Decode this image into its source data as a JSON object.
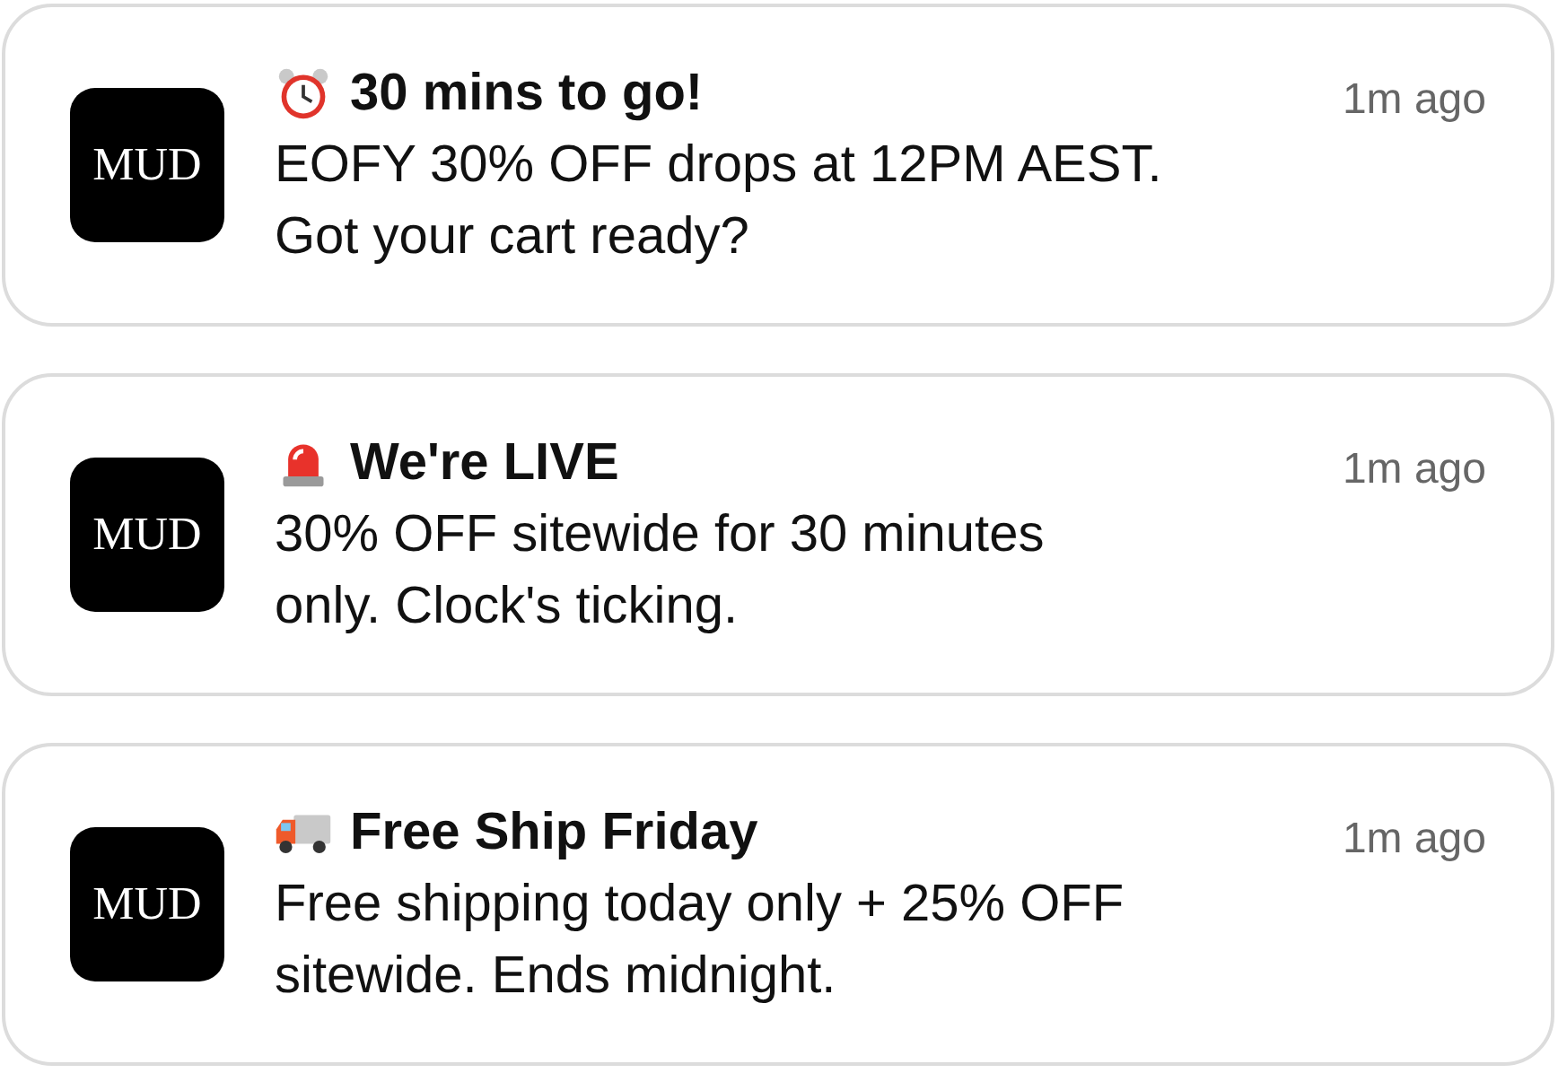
{
  "notifications": [
    {
      "kind": "alarm",
      "logo": "MUD",
      "title": "30 mins to go!",
      "time": "1m ago",
      "lines": [
        "EOFY 30% OFF drops at 12PM AEST.",
        "Got your cart ready?"
      ]
    },
    {
      "kind": "siren",
      "logo": "MUD",
      "title": "We're LIVE",
      "time": "1m ago",
      "lines": [
        "30% OFF sitewide for 30 minutes",
        "only. Clock's ticking."
      ]
    },
    {
      "kind": "truck",
      "logo": "MUD",
      "title": "Free Ship Friday",
      "time": "1m ago",
      "lines": [
        "Free shipping today only + 25% OFF",
        "sitewide. Ends midnight."
      ]
    }
  ]
}
